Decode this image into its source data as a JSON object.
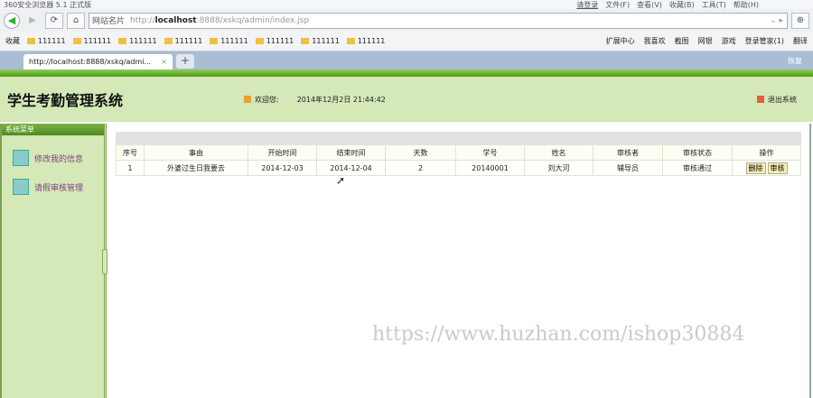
{
  "browser": {
    "title": "360安全浏览器 5.1 正式版",
    "login": "请登录",
    "menu": [
      "文件(F)",
      "查看(V)",
      "收藏(B)",
      "工具(T)",
      "帮助(H)"
    ],
    "site_card": "网站名片",
    "url_prefix": "http://",
    "url_host": "localhost",
    "url_rest": ":8888/xskq/admin/index.jsp",
    "fav_label": "收藏",
    "bookmarks": [
      "111111",
      "111111",
      "111111",
      "111111",
      "111111",
      "111111",
      "111111",
      "111111"
    ],
    "toolbar": [
      "扩展中心",
      "我喜欢",
      "截图",
      "网银",
      "游戏",
      "登录管家(1)",
      "翻译"
    ],
    "tab_title": "http://localhost:8888/xskq/admi...",
    "restore": "恢复"
  },
  "header": {
    "title": "学生考勤管理系统",
    "welcome": "欢迎您:",
    "datetime": "2014年12月2日  21:44:42",
    "logout": "退出系统"
  },
  "sidebar": {
    "title": "系统菜单",
    "items": [
      "修改我的信息",
      "请假审核管理"
    ]
  },
  "table": {
    "columns": [
      "序号",
      "事由",
      "开始时间",
      "结束时间",
      "天数",
      "学号",
      "姓名",
      "审核者",
      "审核状态",
      "操作"
    ],
    "rows": [
      {
        "id": "1",
        "reason": "外婆过生日我要去",
        "start": "2014-12-03",
        "end": "2014-12-04",
        "days": "2",
        "sid": "20140001",
        "name": "刘大河",
        "reviewer": "辅导员",
        "status": "审核通过",
        "delete": "删除",
        "review": "审核"
      }
    ]
  },
  "watermark": "https://www.huzhan.com/ishop30884"
}
